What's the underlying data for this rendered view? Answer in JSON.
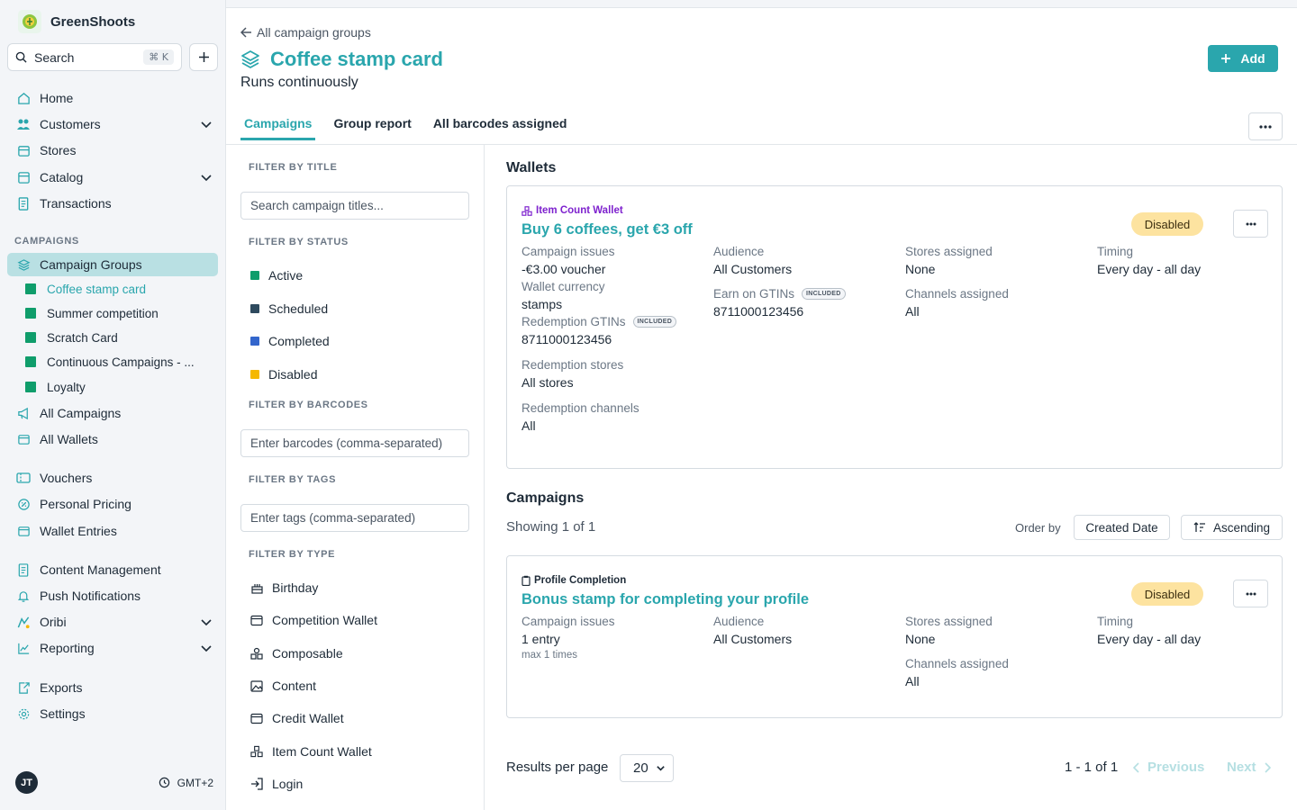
{
  "app": {
    "name": "GreenShoots"
  },
  "search": {
    "label": "Search",
    "shortcut": "⌘ K"
  },
  "sidebar": {
    "items_top": [
      {
        "label": "Home",
        "icon": "home-icon"
      },
      {
        "label": "Customers",
        "icon": "users-icon",
        "expandable": true
      },
      {
        "label": "Stores",
        "icon": "store-icon"
      },
      {
        "label": "Catalog",
        "icon": "catalog-icon",
        "expandable": true
      },
      {
        "label": "Transactions",
        "icon": "receipt-icon"
      }
    ],
    "section_label": "CAMPAIGNS",
    "campaign_groups": {
      "label": "Campaign Groups"
    },
    "groups": [
      {
        "label": "Coffee stamp card",
        "current": true
      },
      {
        "label": "Summer competition"
      },
      {
        "label": "Scratch Card"
      },
      {
        "label": "Continuous Campaigns - ..."
      },
      {
        "label": "Loyalty"
      }
    ],
    "items_mid": [
      {
        "label": "All Campaigns"
      },
      {
        "label": "All Wallets"
      },
      {
        "label": "Vouchers"
      },
      {
        "label": "Personal Pricing"
      },
      {
        "label": "Wallet Entries"
      },
      {
        "label": "Content Management"
      },
      {
        "label": "Push Notifications"
      },
      {
        "label": "Oribi"
      },
      {
        "label": "Reporting"
      },
      {
        "label": "Exports"
      },
      {
        "label": "Settings"
      }
    ],
    "user": {
      "initials": "JT",
      "timezone": "GMT+2"
    },
    "accent_color": "#2aa6ad"
  },
  "header": {
    "back": "All campaign groups",
    "title": "Coffee stamp card",
    "subtitle": "Runs continuously",
    "add_label": "Add",
    "tabs": [
      "Campaigns",
      "Group report",
      "All barcodes assigned"
    ]
  },
  "filters": {
    "title_label": "FILTER BY TITLE",
    "title_placeholder": "Search campaign titles...",
    "status_label": "FILTER BY STATUS",
    "statuses": [
      {
        "label": "Active",
        "color": "#0f9d6b"
      },
      {
        "label": "Scheduled",
        "color": "#2e4a5e"
      },
      {
        "label": "Completed",
        "color": "#3366cc"
      },
      {
        "label": "Disabled",
        "color": "#f5b800"
      }
    ],
    "barcodes_label": "FILTER BY BARCODES",
    "barcodes_placeholder": "Enter barcodes (comma-separated)",
    "tags_label": "FILTER BY TAGS",
    "tags_placeholder": "Enter tags (comma-separated)",
    "type_label": "FILTER BY TYPE",
    "types": [
      {
        "label": "Birthday",
        "icon": "cake-icon"
      },
      {
        "label": "Competition Wallet",
        "icon": "wallet-icon"
      },
      {
        "label": "Composable",
        "icon": "shapes-icon"
      },
      {
        "label": "Content",
        "icon": "image-icon"
      },
      {
        "label": "Credit Wallet",
        "icon": "wallet-icon"
      },
      {
        "label": "Item Count Wallet",
        "icon": "boxes-icon"
      },
      {
        "label": "Login",
        "icon": "login-icon"
      }
    ]
  },
  "wallets": {
    "heading": "Wallets",
    "card": {
      "type": "Item Count Wallet",
      "type_color": "#7e22ce",
      "title": "Buy 6 coffees, get €3 off",
      "status": "Disabled",
      "fields": {
        "campaign_issues_k": "Campaign issues",
        "campaign_issues_v": "-€3.00 voucher",
        "wallet_currency_k": "Wallet currency",
        "wallet_currency_v": "stamps",
        "redemption_gtins_k": "Redemption GTINs",
        "redemption_gtins_v": "8711000123456",
        "redemption_stores_k": "Redemption stores",
        "redemption_stores_v": "All stores",
        "redemption_channels_k": "Redemption channels",
        "redemption_channels_v": "All",
        "audience_k": "Audience",
        "audience_v": "All Customers",
        "earn_gtins_k": "Earn on GTINs",
        "earn_gtins_v": "8711000123456",
        "stores_k": "Stores assigned",
        "stores_v": "None",
        "channels_k": "Channels assigned",
        "channels_v": "All",
        "timing_k": "Timing",
        "timing_v": "Every day - all day"
      },
      "included_badge": "INCLUDED"
    }
  },
  "campaigns": {
    "heading": "Campaigns",
    "showing": "Showing 1 of 1",
    "order_label": "Order by",
    "order_field": "Created Date",
    "order_dir": "Ascending",
    "card": {
      "type": "Profile Completion",
      "title": "Bonus stamp for completing your profile",
      "status": "Disabled",
      "fields": {
        "campaign_issues_k": "Campaign issues",
        "campaign_issues_v": "1 entry",
        "campaign_issues_note": "max 1 times",
        "audience_k": "Audience",
        "audience_v": "All Customers",
        "stores_k": "Stores assigned",
        "stores_v": "None",
        "channels_k": "Channels assigned",
        "channels_v": "All",
        "timing_k": "Timing",
        "timing_v": "Every day - all day"
      }
    }
  },
  "pagination": {
    "rpp_label": "Results per page",
    "rpp_value": "20",
    "range": "1 - 1 of 1",
    "previous": "Previous",
    "next": "Next"
  }
}
